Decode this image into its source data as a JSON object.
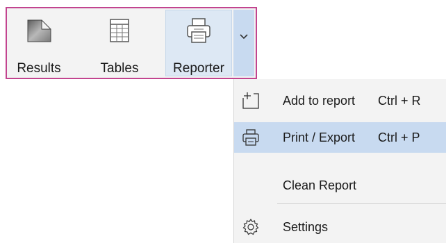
{
  "toolbar": {
    "buttons": [
      {
        "label": "Results",
        "icon": "results-icon"
      },
      {
        "label": "Tables",
        "icon": "table-icon"
      },
      {
        "label": "Reporter",
        "icon": "printer-icon"
      }
    ],
    "dropdown_icon": "chevron-down-icon"
  },
  "menu": {
    "items": [
      {
        "label": "Add to report",
        "shortcut": "Ctrl + R",
        "icon": "add-to-report-icon"
      },
      {
        "label": "Print / Export",
        "shortcut": "Ctrl + P",
        "icon": "printer-icon",
        "highlighted": true
      },
      {
        "label": "Clean Report",
        "shortcut": ""
      },
      {
        "label": "Settings",
        "shortcut": "",
        "icon": "gear-icon"
      }
    ]
  },
  "colors": {
    "accent_border": "#c2448f",
    "highlight": "#c8daf0",
    "selected_button": "#dde8f4"
  }
}
